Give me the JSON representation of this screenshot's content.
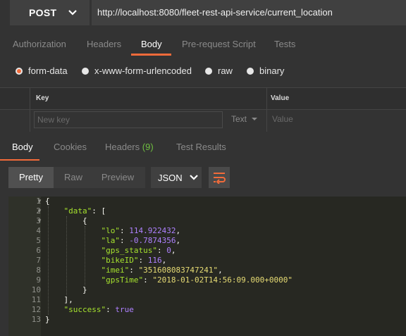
{
  "request": {
    "method": "POST",
    "url": "http://localhost:8080/fleet-rest-api-service/current_location"
  },
  "request_tabs": [
    "Authorization",
    "Headers",
    "Body",
    "Pre-request Script",
    "Tests"
  ],
  "body_types": [
    "form-data",
    "x-www-form-urlencoded",
    "raw",
    "binary"
  ],
  "params_table": {
    "headers": [
      "Key",
      "Value"
    ],
    "key_placeholder": "New key",
    "type": "Text",
    "value_placeholder": "Value"
  },
  "response_tabs": {
    "body": "Body",
    "cookies": "Cookies",
    "headers": "Headers",
    "headers_count": "(9)",
    "tests": "Test Results"
  },
  "view": {
    "modes": [
      "Pretty",
      "Raw",
      "Preview"
    ],
    "format": "JSON"
  },
  "response_body": {
    "line_numbers": [
      "1",
      "2",
      "3",
      "4",
      "5",
      "6",
      "7",
      "8",
      "9",
      "10",
      "11",
      "12",
      "13"
    ],
    "lines": [
      [
        {
          "t": "p",
          "v": "{"
        }
      ],
      [
        {
          "t": "p",
          "v": "    "
        },
        {
          "t": "k",
          "v": "\"data\""
        },
        {
          "t": "p",
          "v": ": ["
        }
      ],
      [
        {
          "t": "p",
          "v": "        {"
        }
      ],
      [
        {
          "t": "p",
          "v": "            "
        },
        {
          "t": "k",
          "v": "\"lo\""
        },
        {
          "t": "p",
          "v": ": "
        },
        {
          "t": "n",
          "v": "114.922432"
        },
        {
          "t": "p",
          "v": ","
        }
      ],
      [
        {
          "t": "p",
          "v": "            "
        },
        {
          "t": "k",
          "v": "\"la\""
        },
        {
          "t": "p",
          "v": ": "
        },
        {
          "t": "n",
          "v": "-0.7874356"
        },
        {
          "t": "p",
          "v": ","
        }
      ],
      [
        {
          "t": "p",
          "v": "            "
        },
        {
          "t": "k",
          "v": "\"gps_status\""
        },
        {
          "t": "p",
          "v": ": "
        },
        {
          "t": "n",
          "v": "0"
        },
        {
          "t": "p",
          "v": ","
        }
      ],
      [
        {
          "t": "p",
          "v": "            "
        },
        {
          "t": "k",
          "v": "\"bikeID\""
        },
        {
          "t": "p",
          "v": ": "
        },
        {
          "t": "n",
          "v": "116"
        },
        {
          "t": "p",
          "v": ","
        }
      ],
      [
        {
          "t": "p",
          "v": "            "
        },
        {
          "t": "k",
          "v": "\"imei\""
        },
        {
          "t": "p",
          "v": ": "
        },
        {
          "t": "s",
          "v": "\"351608083747241\""
        },
        {
          "t": "p",
          "v": ","
        }
      ],
      [
        {
          "t": "p",
          "v": "            "
        },
        {
          "t": "k",
          "v": "\"gpsTime\""
        },
        {
          "t": "p",
          "v": ": "
        },
        {
          "t": "s",
          "v": "\"2018-01-02T14:56:09.000+0000\""
        }
      ],
      [
        {
          "t": "p",
          "v": "        }"
        }
      ],
      [
        {
          "t": "p",
          "v": "    ],"
        }
      ],
      [
        {
          "t": "p",
          "v": "    "
        },
        {
          "t": "k",
          "v": "\"success\""
        },
        {
          "t": "p",
          "v": ": "
        },
        {
          "t": "n",
          "v": "true"
        }
      ],
      [
        {
          "t": "p",
          "v": "}"
        }
      ]
    ]
  },
  "colors": {
    "accent": "#f26b3a",
    "json_key": "#a6e22e",
    "json_string": "#e6db74",
    "json_number": "#ae81ff",
    "headers_count": "#6fbf40"
  }
}
